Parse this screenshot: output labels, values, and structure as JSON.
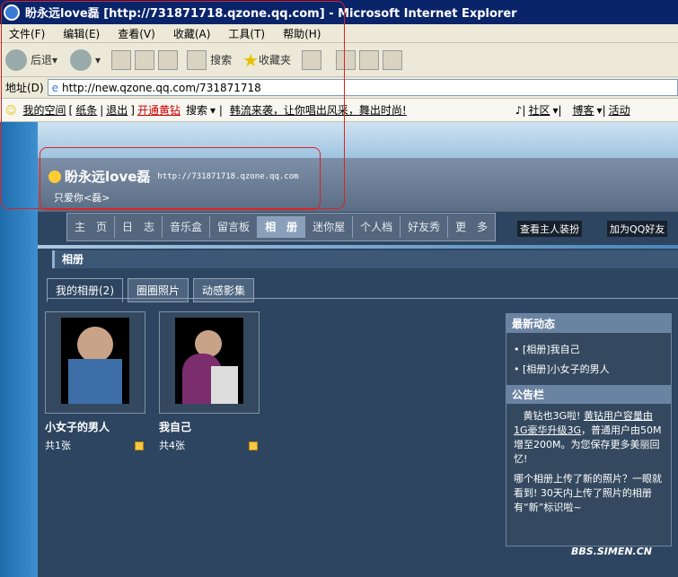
{
  "window": {
    "title": "盼永远love磊 [http://731871718.qzone.qq.com] - Microsoft Internet Explorer"
  },
  "menu": [
    "文件(F)",
    "编辑(E)",
    "查看(V)",
    "收藏(A)",
    "工具(T)",
    "帮助(H)"
  ],
  "toolbar": {
    "back": "后退",
    "search": "搜索",
    "favorites": "收藏夹"
  },
  "address": {
    "label": "地址(D)",
    "url": "http://new.qzone.qq.com/731871718"
  },
  "qqbar": {
    "myspace": "我的空间",
    "note": "纸条",
    "logout": "退出",
    "vip": "开通黄钻",
    "search": "搜索",
    "news": "韩流来袭，让你唱出风采，舞出时尚!",
    "community": "社区",
    "blog": "博客",
    "more": "活动"
  },
  "site": {
    "name": "盼永远love磊",
    "url": "http://731871718.qzone.qq.com",
    "motto": "只爱你<磊>"
  },
  "nav": [
    "主　页",
    "日　志",
    "音乐盒",
    "留言板",
    "相　册",
    "迷你屋",
    "个人档",
    "好友秀",
    "更　多"
  ],
  "nav_active": "相　册",
  "buttons": {
    "decor": "查看主人装扮",
    "addfriend": "加为QQ好友"
  },
  "section": {
    "title": "相册"
  },
  "tabs": [
    "我的相册(2)",
    "圈圈照片",
    "动感影集"
  ],
  "albums": [
    {
      "title": "小女子的男人",
      "count": "共1张"
    },
    {
      "title": "我自己",
      "count": "共4张"
    }
  ],
  "sidebar": {
    "latest_title": "最新动态",
    "latest": [
      "[相册]我自己",
      "[相册]小女子的男人"
    ],
    "notice_title": "公告栏",
    "notice1_a": "黄钻也3G啦!",
    "notice1_link": "黄钻用户容量由1G豪华升级3G",
    "notice1_b": "，普通用户由50M增至200M。为您保存更多美丽回忆!",
    "notice2": "哪个相册上传了新的照片？一眼就看到! 30天内上传了照片的相册有“新”标识啦~"
  },
  "watermark": "BBS.SIMEN.CN"
}
